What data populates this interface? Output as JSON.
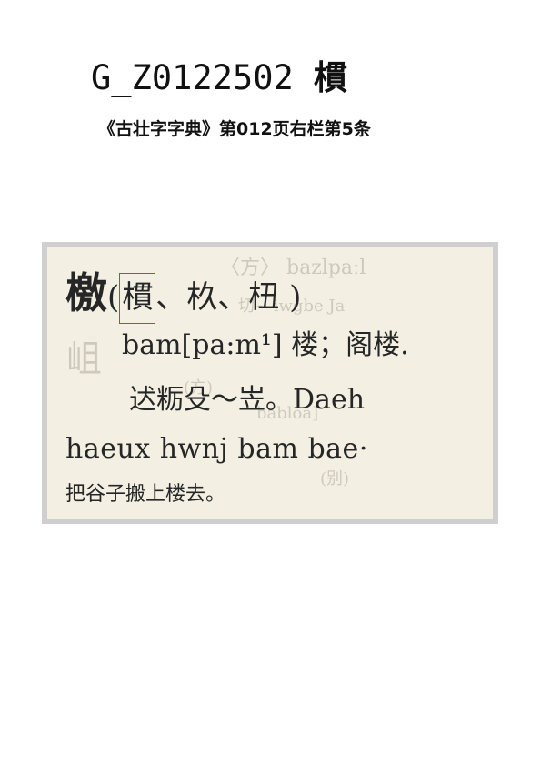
{
  "header": {
    "code": "G_Z0122502",
    "character": "樌",
    "source": "《古壮字字典》第012页右栏第5条"
  },
  "scan": {
    "headword": "檄",
    "paren_open": "(",
    "variant_highlighted": "樌",
    "variants_rest": "、杦、杻 )",
    "pronunciation": "bam[pa:m¹] 楼；阁楼.",
    "example_sawndip": "迖粝殳～岦。Daeh",
    "example_zhuang": "haeux hwnj bam bae·",
    "example_chinese": "把谷子搬上楼去。",
    "faint_bleed": [
      "〈方〉 bazlpaːl",
      "切~ iwgbe Ja",
      "岨",
      "(方)",
      "babloa]",
      "(别)"
    ]
  }
}
